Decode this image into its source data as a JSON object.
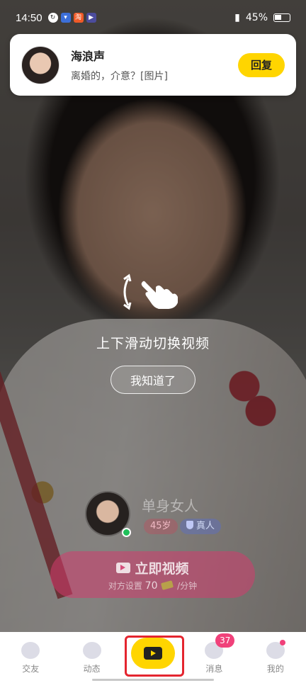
{
  "status_bar": {
    "time": "14:50",
    "battery": "45%"
  },
  "notification": {
    "name": "海浪声",
    "message": "离婚的，介意？[图片]",
    "reply_label": "回复"
  },
  "swipe_hint": {
    "text": "上下滑动切换视频",
    "dismiss_label": "我知道了"
  },
  "host": {
    "name": "单身女人",
    "age_tag": "45岁",
    "verified_tag": "真人",
    "online": true
  },
  "call_button": {
    "label": "立即视频",
    "price_prefix": "对方设置",
    "price": "70",
    "price_suffix": "/分钟"
  },
  "tabs": [
    {
      "label": "交友",
      "icon": "planet-icon"
    },
    {
      "label": "动态",
      "icon": "saturn-icon"
    },
    {
      "label": "",
      "icon": "video-camera-icon",
      "active": true
    },
    {
      "label": "消息",
      "icon": "chat-bubble-icon",
      "badge": "37"
    },
    {
      "label": "我的",
      "icon": "profile-face-icon",
      "dot": true
    }
  ],
  "colors": {
    "accent_yellow": "#ffd500",
    "badge_pink": "#f0417a",
    "highlight_red": "#e4252f",
    "online_green": "#20c05a"
  }
}
